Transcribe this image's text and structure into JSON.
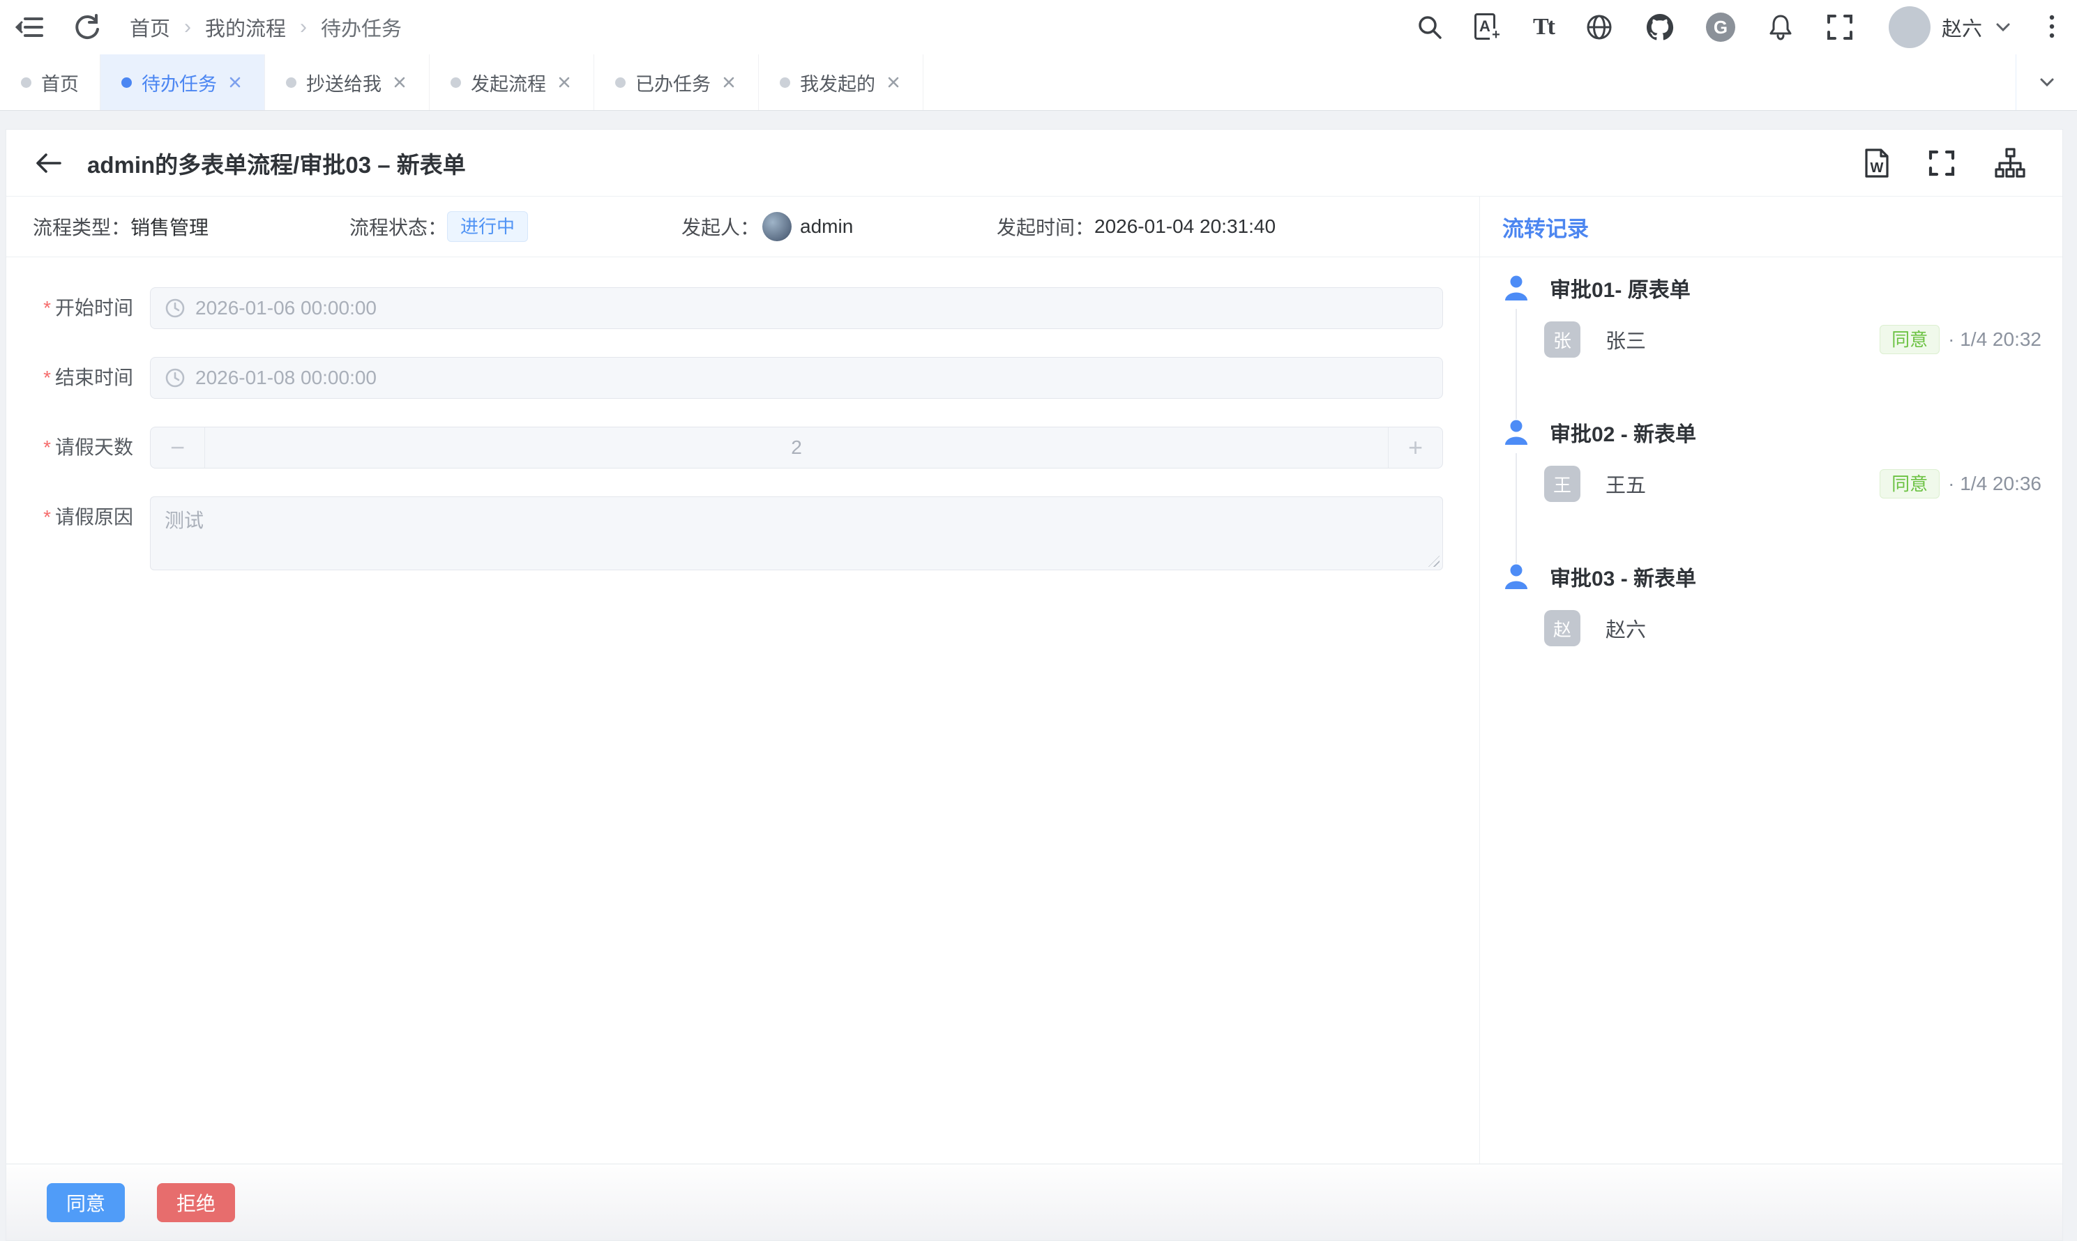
{
  "colors": {
    "primary": "#4b86f2",
    "success": "#67c23a",
    "danger": "#f56c6c",
    "status_processing_bg": "#ecf5ff",
    "status_processing_text": "#5093f4",
    "agree_tag_bg": "#f0f9eb",
    "agree_tag_text": "#6cc243"
  },
  "topbar": {
    "breadcrumb": [
      "首页",
      "我的流程",
      "待办任务"
    ],
    "separator": "›",
    "username": "赵六"
  },
  "icons": {
    "i18n_letter": "A",
    "i18n_plus": "+",
    "font_size": "Tt",
    "gitee": "G",
    "doc": "W"
  },
  "tabs": [
    {
      "label": "首页"
    },
    {
      "label": "待办任务"
    },
    {
      "label": "抄送给我"
    },
    {
      "label": "发起流程"
    },
    {
      "label": "已办任务"
    },
    {
      "label": "我发起的"
    }
  ],
  "detail": {
    "title": "admin的多表单流程/审批03 – 新表单"
  },
  "info": {
    "type_label": "流程类型：",
    "type_value": "销售管理",
    "status_label": "流程状态：",
    "status_value": "进行中",
    "initiator_label": "发起人：",
    "initiator_value": "admin",
    "time_label": "发起时间：",
    "time_value": "2026-01-04 20:31:40"
  },
  "form": {
    "required_mark": "*",
    "minus": "−",
    "plus": "+",
    "fields": [
      {
        "label": "开始时间",
        "value": "2026-01-06 00:00:00"
      },
      {
        "label": "结束时间",
        "value": "2026-01-08 00:00:00"
      },
      {
        "label": "请假天数",
        "value": "2"
      },
      {
        "label": "请假原因",
        "value": "测试"
      }
    ]
  },
  "sidebar": {
    "title": "流转记录",
    "records": [
      {
        "node": "审批01- 原表单",
        "avatar": "张",
        "name": "张三",
        "result": "同意",
        "time": "· 1/4 20:32"
      },
      {
        "node": "审批02 - 新表单",
        "avatar": "王",
        "name": "王五",
        "result": "同意",
        "time": "· 1/4 20:36"
      },
      {
        "node": "审批03 - 新表单",
        "avatar": "赵",
        "name": "赵六"
      }
    ]
  },
  "footer": {
    "approve": "同意",
    "reject": "拒绝"
  }
}
